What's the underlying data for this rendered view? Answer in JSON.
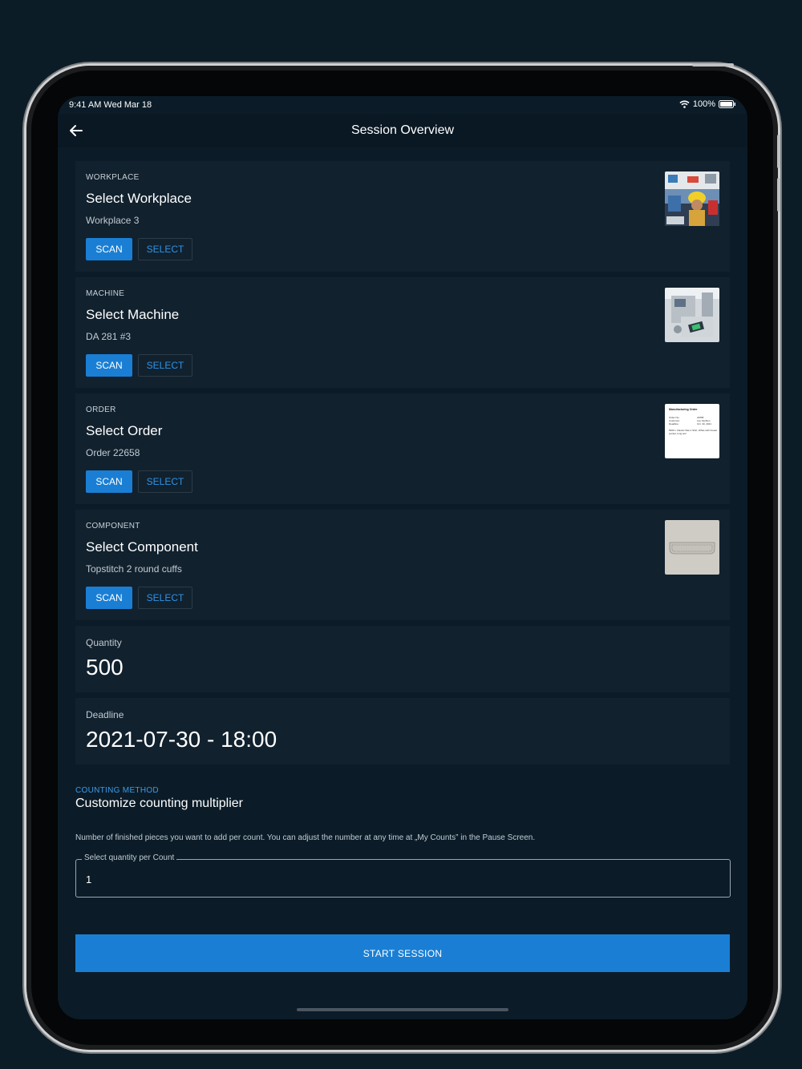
{
  "status": {
    "time": "9:41 AM   Wed Mar 18",
    "battery": "100%"
  },
  "appbar": {
    "title": "Session Overview"
  },
  "cards": [
    {
      "label": "WORKPLACE",
      "title": "Select Workplace",
      "value": "Workplace 3",
      "scan": "SCAN",
      "select": "SELECT"
    },
    {
      "label": "MACHINE",
      "title": "Select Machine",
      "value": "DA 281 #3",
      "scan": "SCAN",
      "select": "SELECT"
    },
    {
      "label": "ORDER",
      "title": "Select Order",
      "value": "Order 22658",
      "scan": "SCAN",
      "select": "SELECT"
    },
    {
      "label": "COMPONENT",
      "title": "Select Component",
      "value": "Topstitch 2 round cuffs",
      "scan": "SCAN",
      "select": "SELECT"
    }
  ],
  "quantity": {
    "label": "Quantity",
    "value": "500"
  },
  "deadline": {
    "label": "Deadline",
    "value": "2021-07-30 - 18:00"
  },
  "counting": {
    "kicker": "COUNTING METHOD",
    "heading": "Customize counting multiplier",
    "description": "Number of finished pieces you want to add per count. You can adjust the number at any time at „My Counts” in the Pause Screen.",
    "field_label": "Select quantity per Count",
    "field_value": "1"
  },
  "start_button": "START SESSION",
  "order_doc": {
    "heading": "Manufacturing Order",
    "rows": [
      [
        "Order No.:",
        "22658"
      ],
      [
        "Customer:",
        "Lee Fashion"
      ],
      [
        "Deadline:",
        "Oct. 30, 2021"
      ]
    ],
    "note": "5000 x Classic Men's Shirt, White with breast pocket, long arm"
  },
  "colors": {
    "accent": "#1a7fd4",
    "card": "#11212e",
    "background": "#0b1c28"
  }
}
